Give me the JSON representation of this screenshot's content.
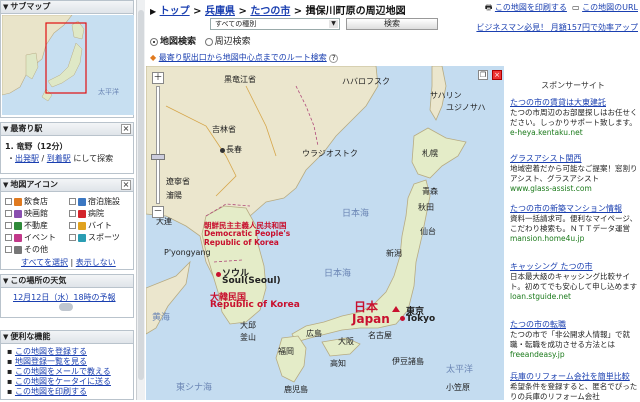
{
  "sidebar": {
    "submap_title": "サブマップ",
    "minimap_sea_label": "太平洋",
    "nearest_station_title": "最寄り駅",
    "station_line": "1. 竜野（12分）",
    "exit_link": "出発駅",
    "arrive_link": "到着駅",
    "explore_text": "にして探索",
    "map_icons_title": "地図アイコン",
    "icons": [
      {
        "label": "飲食店",
        "color": "#e07a1f"
      },
      {
        "label": "宿泊施設",
        "color": "#3b77c2"
      },
      {
        "label": "映画館",
        "color": "#8a4fb0"
      },
      {
        "label": "病院",
        "color": "#d3242b"
      },
      {
        "label": "不動産",
        "color": "#2f8a3a"
      },
      {
        "label": "バイト",
        "color": "#e0a21f"
      },
      {
        "label": "イベント",
        "color": "#c2398a"
      },
      {
        "label": "スポーツ",
        "color": "#2a9db3"
      },
      {
        "label": "その他",
        "color": "#777777"
      }
    ],
    "select_all": "すべてを選択",
    "hide_all": "表示しない",
    "weather_title": "この場所の天気",
    "weather_text": "12月12日（水）18時の予報",
    "tools_title": "便利な機能",
    "tools": [
      "この地図を登録する",
      "地図登録一覧を見る",
      "この地図をメールで教える",
      "この地図をケータイに送る",
      "この地図を印刷する"
    ]
  },
  "header": {
    "crumbs": [
      "トップ",
      "兵庫県",
      "たつの市"
    ],
    "current": "揖保川町原の周辺地図",
    "print_link": "この地図を印刷する",
    "url_link": "この地図のURL",
    "ad_link": "ビジネスマン必見！ 月額157円で効率アップ",
    "select_value": "すべての種別",
    "search_button": "検索",
    "tab_map": "地図検索",
    "tab_nearby": "周辺検索",
    "route_link": "最寄り駅出口から地図中心点までのルート検索"
  },
  "map": {
    "labels": {
      "heilong": "黒竜江省",
      "jilin": "吉林省",
      "changchun": "長春",
      "liaoning": "遼寧省",
      "shenyang": "瀋陽",
      "dalian": "大連",
      "nk_jp": "朝鮮民主主義人民共和国",
      "nk_en1": "Democratic People's",
      "nk_en2": "Republic of Korea",
      "pyongyang": "P'yongyang",
      "seoul_jp": "ソウル",
      "seoul_en": "Soul(Seoul)",
      "kr_jp": "大韓民国",
      "kr_en": "Republic of Korea",
      "daegu": "大邱",
      "busan": "釜山",
      "yellow_sea": "黄海",
      "east_china_sea": "東シナ海",
      "sea_of_japan": "日本海",
      "sea_of_japan2": "日本海",
      "vladivostok": "ウラジオストク",
      "khabarovsk": "ハバロフスク",
      "sakhalin": "サハリン",
      "yuzhno": "ユジノサハ",
      "sapporo": "札幌",
      "aomori": "青森",
      "akita": "秋田",
      "sendai": "仙台",
      "niigata": "新潟",
      "japan_jp": "日本",
      "japan_en": "Japan",
      "tokyo_jp": "東京",
      "tokyo_en": "Tokyo",
      "nagoya": "名古屋",
      "osaka": "大阪",
      "fukuoka": "福岡",
      "hiroshima": "広島",
      "kochi": "高知",
      "kagoshima": "鹿児島",
      "izu": "伊豆諸島",
      "pacific": "太平洋",
      "ogasawara": "小笠原"
    }
  },
  "sponsor": {
    "title": "スポンサーサイト",
    "ads": [
      {
        "title": "たつの市の賃貸は大東建託",
        "body": "たつの市周辺のお部屋探しはお任せください。しっかりサポート致します。",
        "url": "e-heya.kentaku.net"
      },
      {
        "title": "グラスアシスト関西",
        "body": "地域密着だから可能なご提案！窓割りアシスト、グラスアシスト",
        "url": "www.glass-assist.com"
      },
      {
        "title": "たつの市の新築マンション情報",
        "body": "資料一括請求可。便利なマイページ、こだわり検索も。ＮＴＴデータ運営",
        "url": "mansion.home4u.jp"
      },
      {
        "title": "キャッシング たつの市",
        "body": "日本最大級のキャッシング比較サイト。初めてでも安心して申し込めます",
        "url": "loan.stguide.net"
      },
      {
        "title": "たつの市の転職",
        "body": "たつの市で「非公開求人情報」で就職・転職を成功させる方法とは",
        "url": "freeandeasy.jp"
      },
      {
        "title": "兵庫のリフォーム会社を簡単比較",
        "body": "希望条件を登録すると、匿名でぴったりの兵庫のリフォーム会社",
        "url": ""
      }
    ]
  }
}
